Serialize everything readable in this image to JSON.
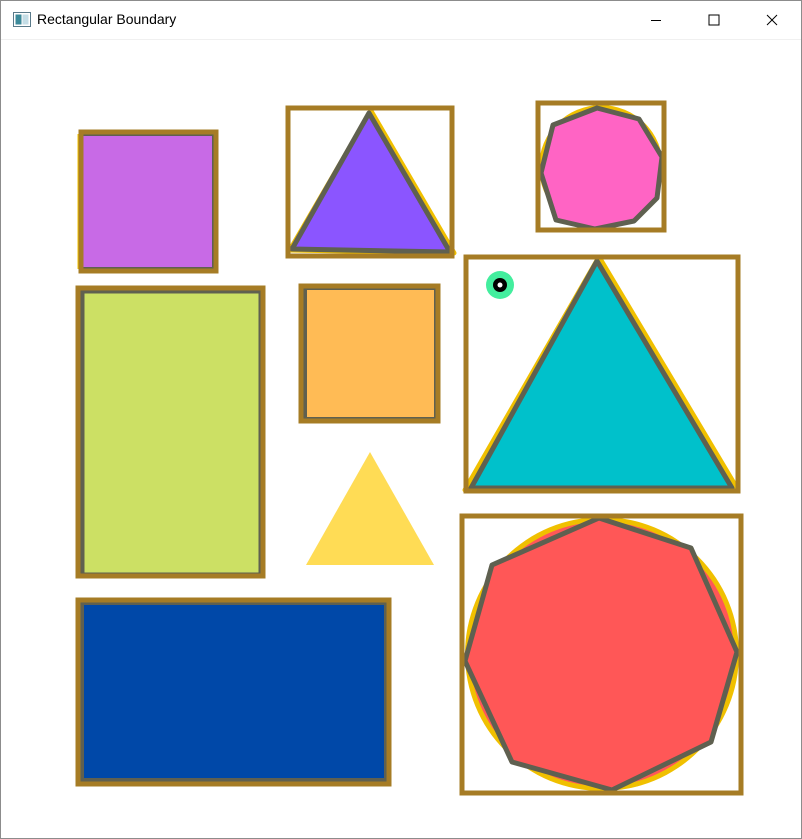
{
  "window": {
    "title": "Rectangular Boundary",
    "controls": [
      "minimize-icon",
      "maximize-icon",
      "close-icon"
    ]
  },
  "colors": {
    "boundary": "#a67c25",
    "outline": "#5f6050",
    "highlight": "#f0c000",
    "purple_square": "#c86ae6",
    "violet_triangle": "#8b55ff",
    "pink_octagon": "#ff64c4",
    "green_rectangle": "#cce064",
    "orange_square": "#ffbb55",
    "cyan_triangle": "#00c1cb",
    "yellow_triangle": "#ffdc55",
    "blue_rectangle": "#0048a8",
    "red_octagon": "#ff5757",
    "marker_ring": "#43ee9e",
    "marker_dot": "#000000"
  },
  "shapes": [
    "purple-square",
    "violet-triangle",
    "pink-octagon",
    "green-rectangle",
    "orange-square",
    "cyan-triangle",
    "yellow-triangle",
    "blue-rectangle",
    "red-octagon",
    "green-marker"
  ]
}
